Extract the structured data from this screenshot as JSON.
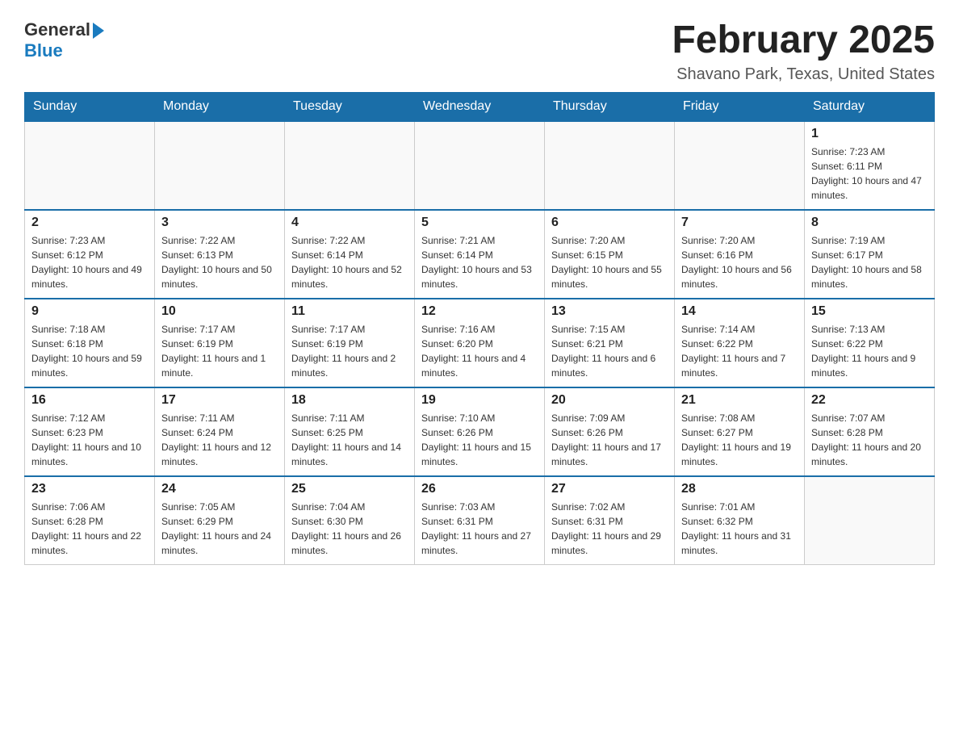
{
  "header": {
    "logo_general": "General",
    "logo_blue": "Blue",
    "month_title": "February 2025",
    "location": "Shavano Park, Texas, United States"
  },
  "days_of_week": [
    "Sunday",
    "Monday",
    "Tuesday",
    "Wednesday",
    "Thursday",
    "Friday",
    "Saturday"
  ],
  "weeks": [
    [
      {
        "day": "",
        "info": ""
      },
      {
        "day": "",
        "info": ""
      },
      {
        "day": "",
        "info": ""
      },
      {
        "day": "",
        "info": ""
      },
      {
        "day": "",
        "info": ""
      },
      {
        "day": "",
        "info": ""
      },
      {
        "day": "1",
        "info": "Sunrise: 7:23 AM\nSunset: 6:11 PM\nDaylight: 10 hours and 47 minutes."
      }
    ],
    [
      {
        "day": "2",
        "info": "Sunrise: 7:23 AM\nSunset: 6:12 PM\nDaylight: 10 hours and 49 minutes."
      },
      {
        "day": "3",
        "info": "Sunrise: 7:22 AM\nSunset: 6:13 PM\nDaylight: 10 hours and 50 minutes."
      },
      {
        "day": "4",
        "info": "Sunrise: 7:22 AM\nSunset: 6:14 PM\nDaylight: 10 hours and 52 minutes."
      },
      {
        "day": "5",
        "info": "Sunrise: 7:21 AM\nSunset: 6:14 PM\nDaylight: 10 hours and 53 minutes."
      },
      {
        "day": "6",
        "info": "Sunrise: 7:20 AM\nSunset: 6:15 PM\nDaylight: 10 hours and 55 minutes."
      },
      {
        "day": "7",
        "info": "Sunrise: 7:20 AM\nSunset: 6:16 PM\nDaylight: 10 hours and 56 minutes."
      },
      {
        "day": "8",
        "info": "Sunrise: 7:19 AM\nSunset: 6:17 PM\nDaylight: 10 hours and 58 minutes."
      }
    ],
    [
      {
        "day": "9",
        "info": "Sunrise: 7:18 AM\nSunset: 6:18 PM\nDaylight: 10 hours and 59 minutes."
      },
      {
        "day": "10",
        "info": "Sunrise: 7:17 AM\nSunset: 6:19 PM\nDaylight: 11 hours and 1 minute."
      },
      {
        "day": "11",
        "info": "Sunrise: 7:17 AM\nSunset: 6:19 PM\nDaylight: 11 hours and 2 minutes."
      },
      {
        "day": "12",
        "info": "Sunrise: 7:16 AM\nSunset: 6:20 PM\nDaylight: 11 hours and 4 minutes."
      },
      {
        "day": "13",
        "info": "Sunrise: 7:15 AM\nSunset: 6:21 PM\nDaylight: 11 hours and 6 minutes."
      },
      {
        "day": "14",
        "info": "Sunrise: 7:14 AM\nSunset: 6:22 PM\nDaylight: 11 hours and 7 minutes."
      },
      {
        "day": "15",
        "info": "Sunrise: 7:13 AM\nSunset: 6:22 PM\nDaylight: 11 hours and 9 minutes."
      }
    ],
    [
      {
        "day": "16",
        "info": "Sunrise: 7:12 AM\nSunset: 6:23 PM\nDaylight: 11 hours and 10 minutes."
      },
      {
        "day": "17",
        "info": "Sunrise: 7:11 AM\nSunset: 6:24 PM\nDaylight: 11 hours and 12 minutes."
      },
      {
        "day": "18",
        "info": "Sunrise: 7:11 AM\nSunset: 6:25 PM\nDaylight: 11 hours and 14 minutes."
      },
      {
        "day": "19",
        "info": "Sunrise: 7:10 AM\nSunset: 6:26 PM\nDaylight: 11 hours and 15 minutes."
      },
      {
        "day": "20",
        "info": "Sunrise: 7:09 AM\nSunset: 6:26 PM\nDaylight: 11 hours and 17 minutes."
      },
      {
        "day": "21",
        "info": "Sunrise: 7:08 AM\nSunset: 6:27 PM\nDaylight: 11 hours and 19 minutes."
      },
      {
        "day": "22",
        "info": "Sunrise: 7:07 AM\nSunset: 6:28 PM\nDaylight: 11 hours and 20 minutes."
      }
    ],
    [
      {
        "day": "23",
        "info": "Sunrise: 7:06 AM\nSunset: 6:28 PM\nDaylight: 11 hours and 22 minutes."
      },
      {
        "day": "24",
        "info": "Sunrise: 7:05 AM\nSunset: 6:29 PM\nDaylight: 11 hours and 24 minutes."
      },
      {
        "day": "25",
        "info": "Sunrise: 7:04 AM\nSunset: 6:30 PM\nDaylight: 11 hours and 26 minutes."
      },
      {
        "day": "26",
        "info": "Sunrise: 7:03 AM\nSunset: 6:31 PM\nDaylight: 11 hours and 27 minutes."
      },
      {
        "day": "27",
        "info": "Sunrise: 7:02 AM\nSunset: 6:31 PM\nDaylight: 11 hours and 29 minutes."
      },
      {
        "day": "28",
        "info": "Sunrise: 7:01 AM\nSunset: 6:32 PM\nDaylight: 11 hours and 31 minutes."
      },
      {
        "day": "",
        "info": ""
      }
    ]
  ]
}
